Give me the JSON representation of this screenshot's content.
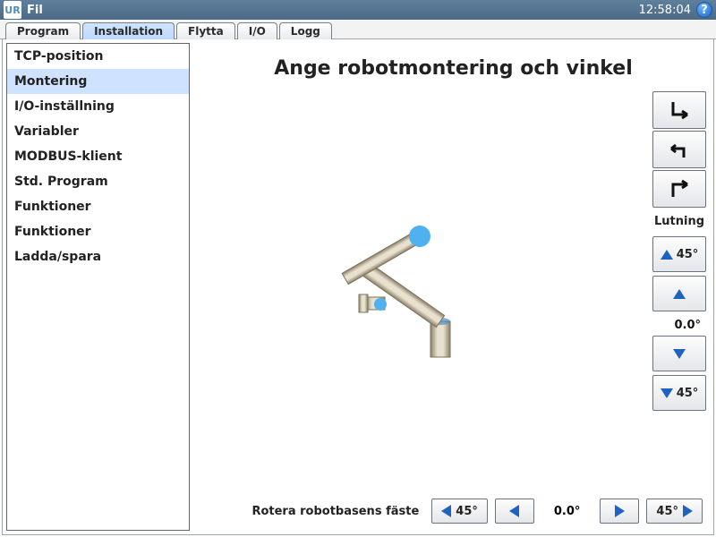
{
  "topbar": {
    "logo_text": "UR",
    "menu_label": "Fil",
    "clock": "12:58:04",
    "help_glyph": "?"
  },
  "tabs": [
    {
      "label": "Program",
      "active": false
    },
    {
      "label": "Installation",
      "active": true
    },
    {
      "label": "Flytta",
      "active": false
    },
    {
      "label": "I/O",
      "active": false
    },
    {
      "label": "Logg",
      "active": false
    }
  ],
  "sidebar": {
    "items": [
      "TCP-position",
      "Montering",
      "I/O-inställning",
      "Variabler",
      "MODBUS-klient",
      "Std. Program",
      "Funktioner",
      "Funktioner",
      "Ladda/spara"
    ],
    "selected_index": 1
  },
  "main": {
    "title": "Ange robotmontering och vinkel"
  },
  "tilt": {
    "label": "Lutning",
    "step": "45°",
    "value": "0.0°"
  },
  "rotate": {
    "label": "Rotera robotbasens fäste",
    "step": "45°",
    "value": "0.0°"
  }
}
